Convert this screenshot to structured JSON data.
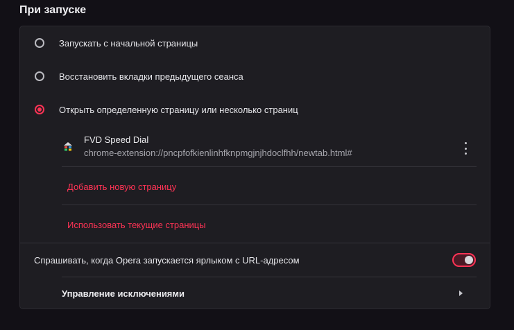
{
  "section": {
    "title": "При запуске"
  },
  "startup_options": [
    {
      "label": "Запускать с начальной страницы",
      "checked": false
    },
    {
      "label": "Восстановить вкладки предыдущего сеанса",
      "checked": false
    },
    {
      "label": "Открыть определенную страницу или несколько страниц",
      "checked": true
    }
  ],
  "pages": [
    {
      "title": "FVD Speed Dial",
      "url": "chrome-extension://pncpfofkienlinhfknpmgjnjhdoclfhh/newtab.html#",
      "icon": "fvd-speed-dial-icon"
    }
  ],
  "links": {
    "add_page": "Добавить новую страницу",
    "use_current": "Использовать текущие страницы"
  },
  "ask_on_url": {
    "label": "Спрашивать, когда Opera запускается ярлыком с URL-адресом",
    "enabled": true
  },
  "exceptions": {
    "label": "Управление исключениями"
  },
  "colors": {
    "accent": "#ff3355",
    "card": "#1e1d22",
    "background": "#121016"
  }
}
